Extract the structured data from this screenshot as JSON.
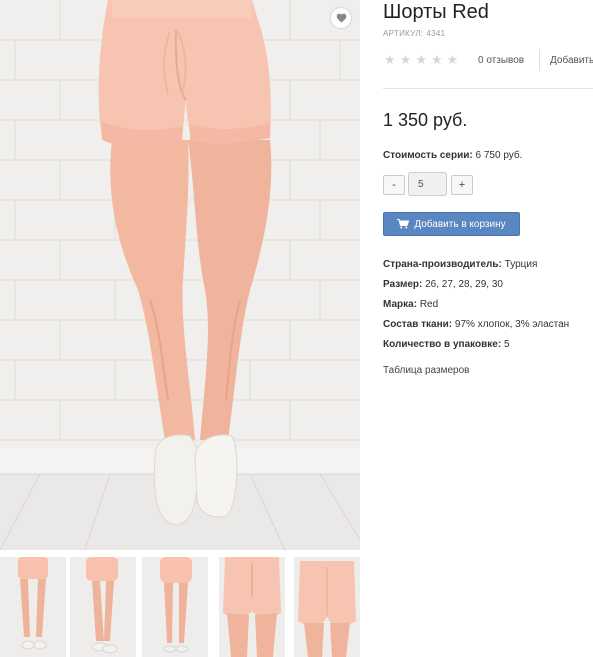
{
  "product": {
    "title": "Шорты Red",
    "sku_label": "АРТИКУЛ:",
    "sku_value": "4341",
    "rating": {
      "stars_filled": 0,
      "stars_total": 5
    },
    "reviews_count_text": "0 отзывов",
    "add_review_text": "Добавить",
    "price": "1 350 руб.",
    "series_cost_label": "Стоимость серии:",
    "series_cost_value": "6 750 руб.",
    "quantity": {
      "minus_label": "-",
      "value": "5",
      "plus_label": "+"
    },
    "add_to_cart_label": "Добавить в корзину",
    "properties": [
      {
        "label": "Страна-производитель:",
        "value": "Турция"
      },
      {
        "label": "Размер:",
        "value": "26, 27, 28, 29, 30"
      },
      {
        "label": "Марка:",
        "value": "Red"
      },
      {
        "label": "Состав ткани:",
        "value": "97% хлопок, 3% эластан"
      },
      {
        "label": "Количество в упаковке:",
        "value": "5"
      }
    ],
    "size_table_link": "Таблица размеров"
  },
  "gallery": {
    "thumbnails": [
      "front-full",
      "side-full",
      "back-full",
      "front-closeup",
      "back-closeup"
    ]
  },
  "icons": {
    "favorite": "heart-icon",
    "star": "star-icon",
    "cart": "cart-icon"
  },
  "colors": {
    "shorts": "#f7c3b1",
    "wall": "#f2f0ee",
    "button": "#5a87c1",
    "star_empty": "#d6d6d6"
  }
}
